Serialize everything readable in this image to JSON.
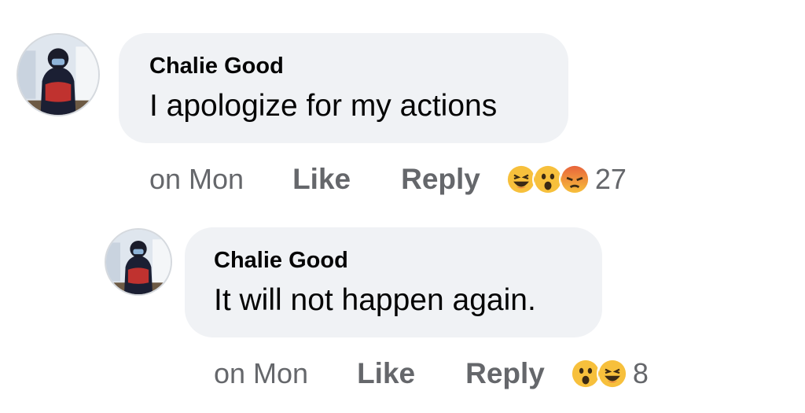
{
  "comments": [
    {
      "author": "Chalie Good",
      "text": "I apologize for my actions",
      "time": "on Mon",
      "like_label": "Like",
      "reply_label": "Reply",
      "reactions": [
        "haha",
        "wow",
        "angry"
      ],
      "reaction_count": "27"
    },
    {
      "author": "Chalie Good",
      "text": "It will not happen again.",
      "time": "on Mon",
      "like_label": "Like",
      "reply_label": "Reply",
      "reactions": [
        "wow",
        "haha"
      ],
      "reaction_count": "8"
    }
  ],
  "colors": {
    "bubble": "#f0f2f5",
    "meta_text": "#65676b",
    "text": "#050505",
    "emoji_yellow": "#f7c03c",
    "emoji_angry": "#e8643c"
  }
}
